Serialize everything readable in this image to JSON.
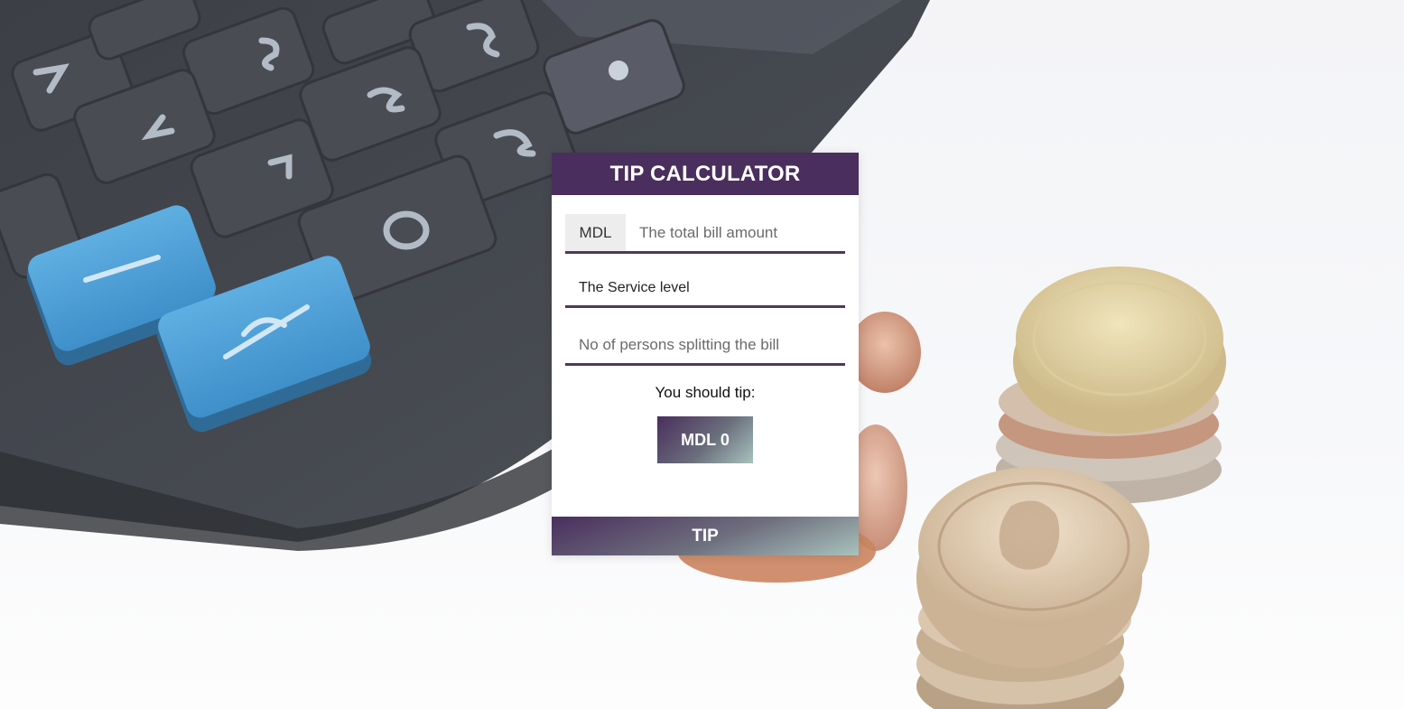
{
  "app": {
    "title": "TIP CALCULATOR"
  },
  "bill": {
    "currency": "MDL",
    "placeholder": "The total bill amount",
    "value": ""
  },
  "service": {
    "selected": "The Service level"
  },
  "persons": {
    "placeholder": "No of persons splitting the bill",
    "value": ""
  },
  "result": {
    "label": "You should tip:",
    "value": "MDL 0"
  },
  "actions": {
    "tip_label": "TIP"
  },
  "theme": {
    "primary": "#4a2e5d",
    "accent_end": "#a9c2bd",
    "background": "#f3f4f7"
  },
  "background_image": {
    "description_icon": "calculator-and-coins-photo"
  }
}
